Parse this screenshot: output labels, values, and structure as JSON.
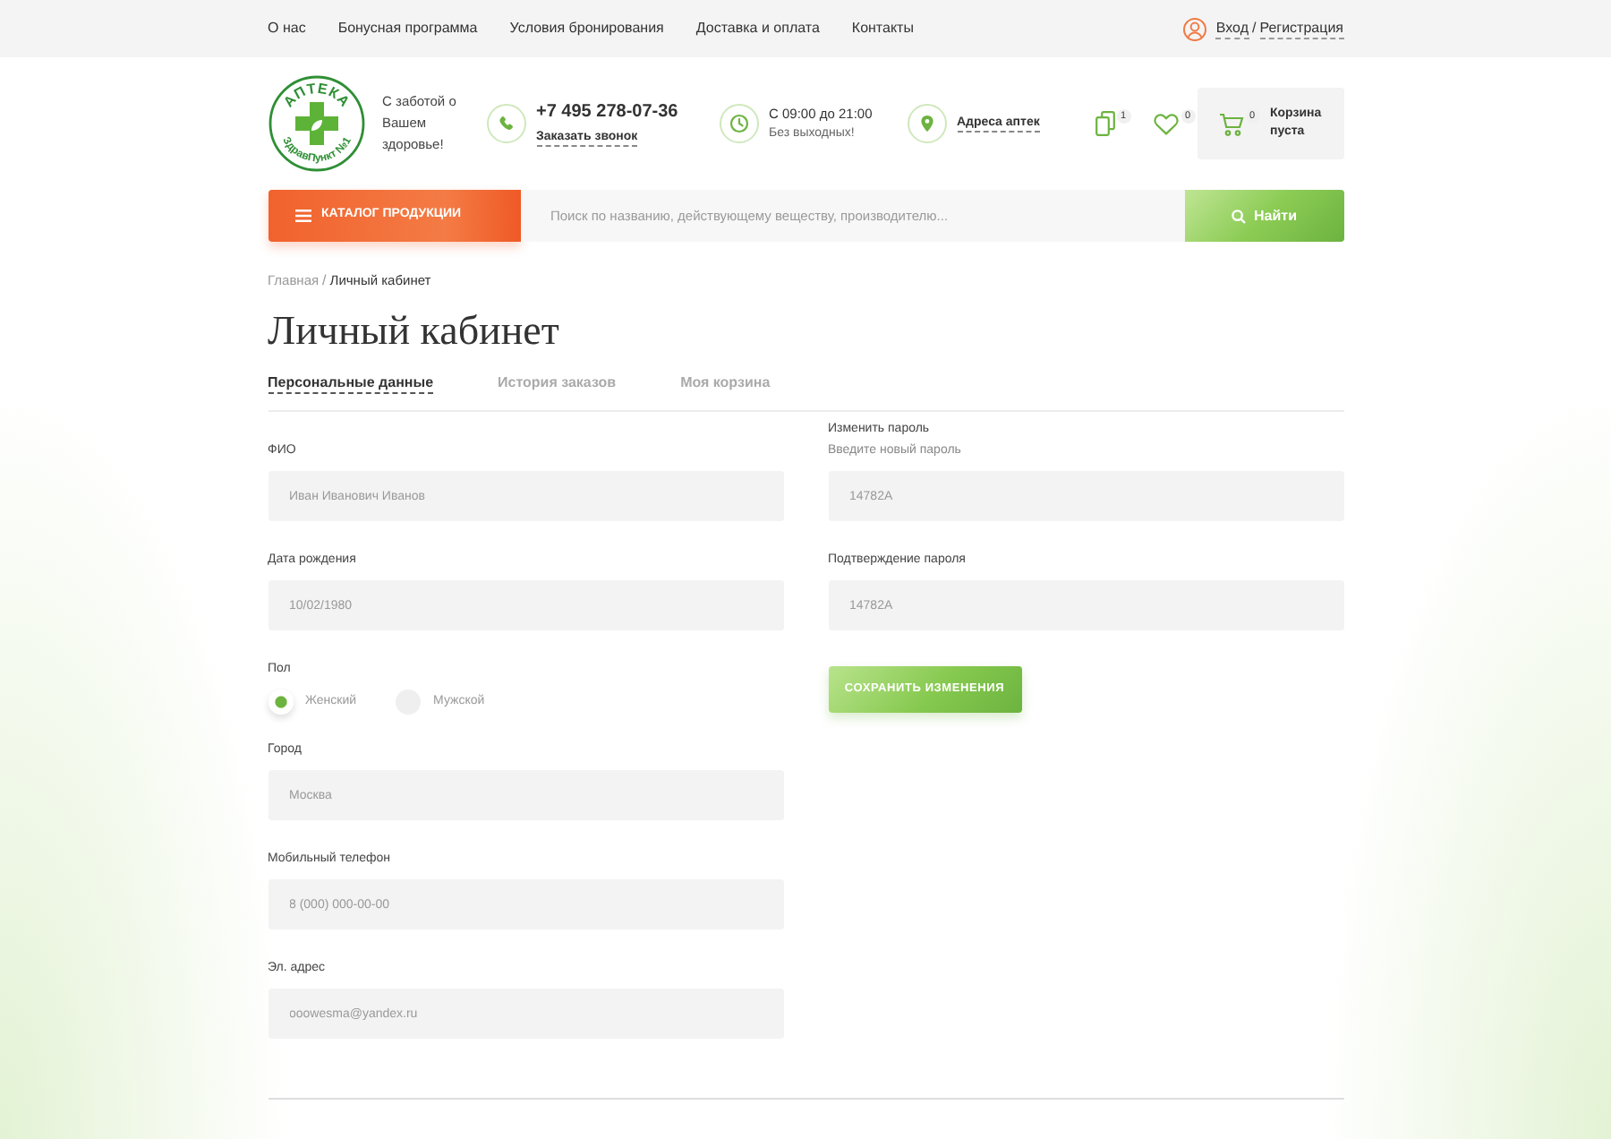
{
  "top_nav": {
    "links": [
      "О нас",
      "Бонусная программа",
      "Условия бронирования",
      "Доставка и оплата",
      "Контакты"
    ],
    "login": "Вход",
    "separator": "/",
    "register": "Регистрация"
  },
  "header": {
    "logo": {
      "top_text": "АПТЕКА",
      "bottom_text": "ЗдравПункт №1"
    },
    "tagline": "С заботой о Вашем здоровье!",
    "phone": "+7 495 278-07-36",
    "callback_link": "Заказать звонок",
    "hours": "С 09:00 до 21:00",
    "days_note": "Без выходных!",
    "stores_link": "Адреса аптек",
    "compare_count": "1",
    "favorites_count": "0",
    "cart_count": "0",
    "cart_label": "Корзина пуста"
  },
  "search": {
    "catalog_button": "КАТАЛОГ ПРОДУКЦИИ",
    "placeholder": "Поиск по названию, действующему веществу, производителю...",
    "button": "Найти"
  },
  "breadcrumb": {
    "items": [
      "Главная",
      "Личный кабинет"
    ],
    "separator": "/"
  },
  "page_title": "Личный кабинет",
  "tabs": [
    {
      "label": "Персональные данные",
      "selected": true
    },
    {
      "label": "История заказов",
      "selected": false
    },
    {
      "label": "Моя корзина",
      "selected": false
    }
  ],
  "form": {
    "left_fields": [
      {
        "kind": "text",
        "label": "ФИО",
        "value": "Иван Иванович Иванов"
      },
      {
        "kind": "text",
        "label": "Дата рождения",
        "value": "10/02/1980"
      },
      {
        "kind": "radio",
        "label": "Пол",
        "options": [
          {
            "label": "Женский",
            "selected": true
          },
          {
            "label": "Мужской",
            "selected": false
          }
        ]
      },
      {
        "kind": "text",
        "label": "Город",
        "value": "Москва"
      },
      {
        "kind": "text",
        "label": "Мобильный телефон",
        "value": "8 (000) 000-00-00"
      },
      {
        "kind": "text",
        "label": "Эл. адрес",
        "value": "ooowesma@yandex.ru"
      }
    ],
    "right_fields": [
      {
        "kind": "text",
        "label": "Изменить пароль",
        "hint": "Введите новый пароль",
        "value": "14782A"
      },
      {
        "kind": "text",
        "label": "Подтверждение пароля",
        "value": "14782A"
      }
    ],
    "save_button": "СОХРАНИТЬ ИЗМЕНЕНИЯ"
  }
}
